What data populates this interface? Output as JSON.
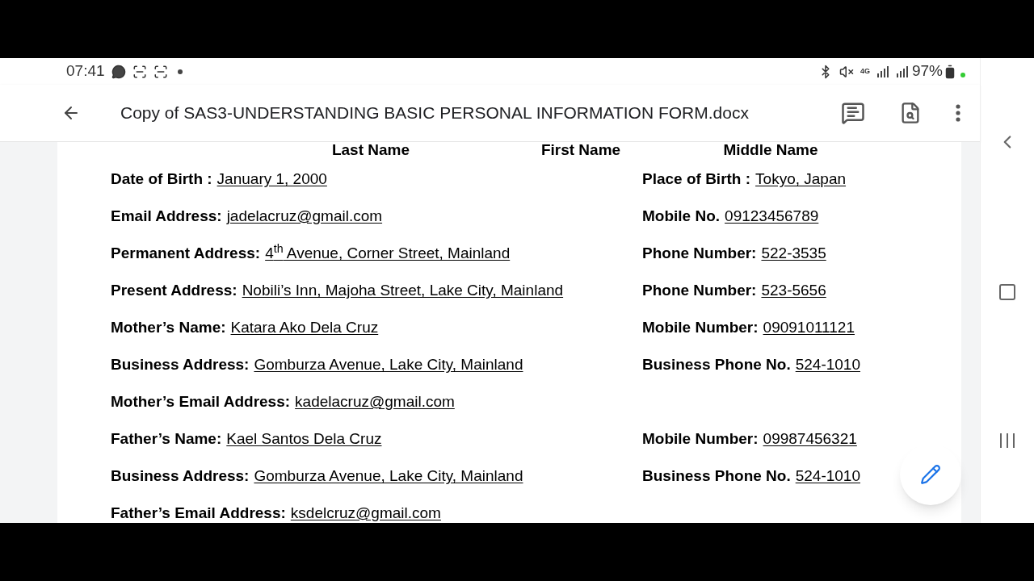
{
  "status_bar": {
    "time": "07:41",
    "network": "4G",
    "battery": "97%"
  },
  "app_bar": {
    "title": "Copy of SAS3-UNDERSTANDING BASIC PERSONAL INFORMATION FORM.docx"
  },
  "document": {
    "name_headings": [
      "Last Name",
      "First Name",
      "Middle Name"
    ],
    "rows": [
      {
        "left": {
          "label": "Date of Birth :",
          "value": "January 1, 2000"
        },
        "right": {
          "label": "Place of Birth :",
          "value": "Tokyo, Japan"
        }
      },
      {
        "left": {
          "label": "Email Address:",
          "value": "jadelacruz@gmail.com"
        },
        "right": {
          "label": "Mobile No.",
          "value": "09123456789"
        }
      },
      {
        "left": {
          "label": "Permanent Address:",
          "value": "4$^{th}$ Avenue, Corner Street, Mainland"
        },
        "right": {
          "label": "Phone Number:",
          "value": "522-3535"
        }
      },
      {
        "left": {
          "label": "Present Address:",
          "value": "Nobili’s Inn, Majoha Street, Lake City, Mainland"
        },
        "right": {
          "label": "Phone Number:",
          "value": "523-5656"
        }
      },
      {
        "left": {
          "label": "Mother’s Name:",
          "value": "Katara Ako Dela Cruz"
        },
        "right": {
          "label": "Mobile Number:",
          "value": "09091011121"
        }
      },
      {
        "left": {
          "label": "Business Address:",
          "value": "Gomburza Avenue, Lake City, Mainland"
        },
        "right": {
          "label": "Business Phone No.",
          "value": "524-1010"
        }
      },
      {
        "left": {
          "label": "Mother’s Email Address:",
          "value": "kadelacruz@gmail.com"
        }
      },
      {
        "left": {
          "label": "Father’s Name:",
          "value": "Kael Santos Dela Cruz"
        },
        "right": {
          "label": "Mobile Number:",
          "value": "09987456321"
        }
      },
      {
        "left": {
          "label": "Business Address:",
          "value": "Gomburza Avenue, Lake City, Mainland"
        },
        "right": {
          "label": "Business Phone No.",
          "value": "524-1010"
        }
      },
      {
        "left": {
          "label": "Father’s Email Address:",
          "value": "ksdelcruz@gmail.com"
        }
      }
    ]
  }
}
